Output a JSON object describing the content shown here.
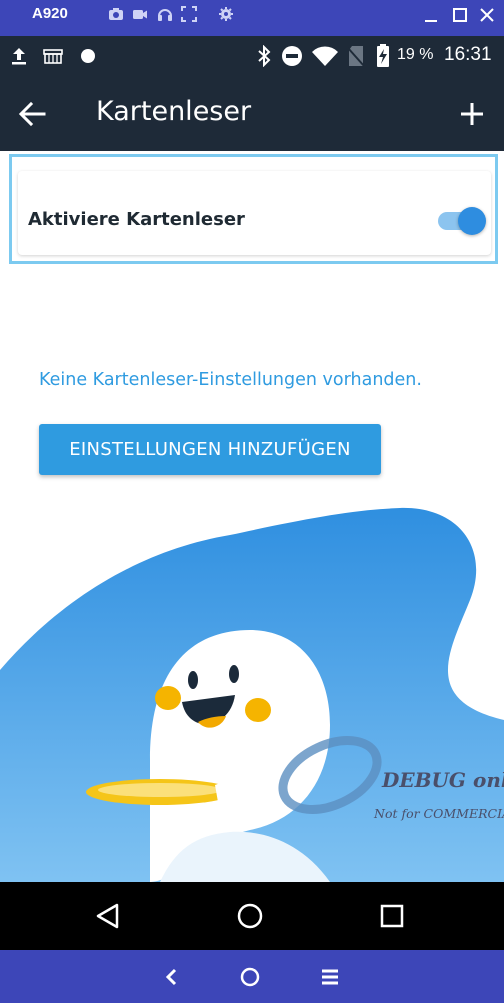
{
  "emulator": {
    "title": "A920",
    "tools": [
      "camera-icon",
      "video-icon",
      "headset-icon",
      "fullscreen-icon",
      "settings-icon"
    ],
    "window_controls": [
      "minimize-icon",
      "maximize-icon",
      "close-icon"
    ],
    "bottom_controls": [
      "back-icon",
      "home-icon",
      "menu-icon"
    ]
  },
  "status_bar": {
    "left_icons": [
      "upload-icon",
      "store-icon",
      "dot-icon"
    ],
    "right_icons": [
      "bluetooth-icon",
      "do-not-disturb-icon",
      "wifi-icon",
      "no-sim-icon",
      "battery-charging-icon"
    ],
    "battery": "19 %",
    "time": "16:31"
  },
  "toolbar": {
    "title": "Kartenleser",
    "back_icon": "arrow-left-icon",
    "add_icon": "plus-icon"
  },
  "card": {
    "label": "Aktiviere Kartenleser",
    "toggle_on": true
  },
  "empty_state": {
    "message": "Keine Kartenleser-Einstellungen vorhanden.",
    "button_label": "EINSTELLUNGEN HINZUFÜGEN"
  },
  "watermark": {
    "line1": "DEBUG only",
    "line2": "Not for COMMERCIAL"
  },
  "nav_bar": {
    "buttons": [
      "back-triangle-icon",
      "home-circle-icon",
      "recents-square-icon"
    ]
  },
  "colors": {
    "accent": "#2f9be0",
    "toolbar": "#1e2a38",
    "emulator": "#3d46b8",
    "highlight_border": "#7ccaf0"
  }
}
